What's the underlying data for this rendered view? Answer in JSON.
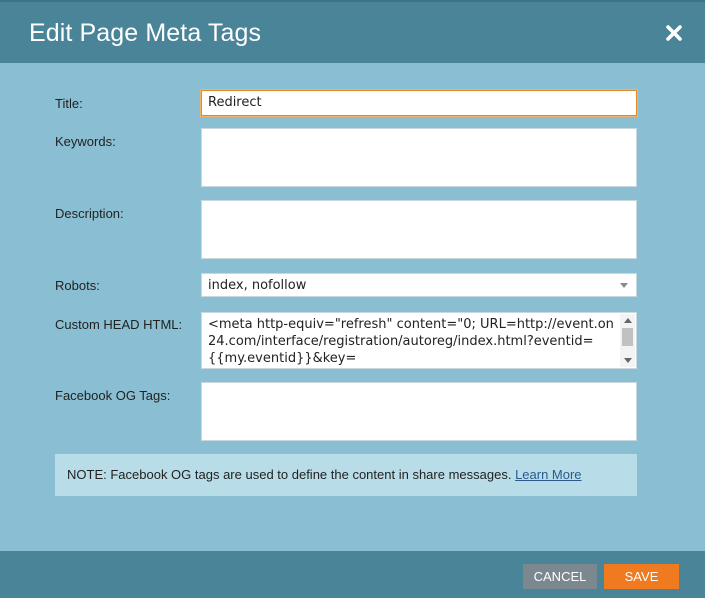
{
  "dialog": {
    "title": "Edit Page Meta Tags",
    "close_icon": "close-icon"
  },
  "form": {
    "title_label": "Title:",
    "title_value": "Redirect",
    "keywords_label": "Keywords:",
    "keywords_value": "",
    "description_label": "Description:",
    "description_value": "",
    "robots_label": "Robots:",
    "robots_value": "index, nofollow",
    "custom_head_label": "Custom HEAD HTML:",
    "custom_head_value": "<meta http-equiv=\"refresh\" content=\"0; URL=http://event.on24.com/interface/registration/autoreg/index.html?eventid={{my.eventid}}&key=",
    "og_label": "Facebook OG Tags:",
    "og_value": ""
  },
  "note": {
    "prefix": "NOTE:",
    "text": "Facebook OG tags are used to define the content in share messages.",
    "link": "Learn More"
  },
  "footer": {
    "cancel_label": "CANCEL",
    "save_label": "SAVE"
  },
  "colors": {
    "header_bg": "#4a8499",
    "body_bg": "#8abfd3",
    "save_bg": "#f07a20",
    "cancel_bg": "#7b8890",
    "note_bg": "#b9dde8"
  }
}
